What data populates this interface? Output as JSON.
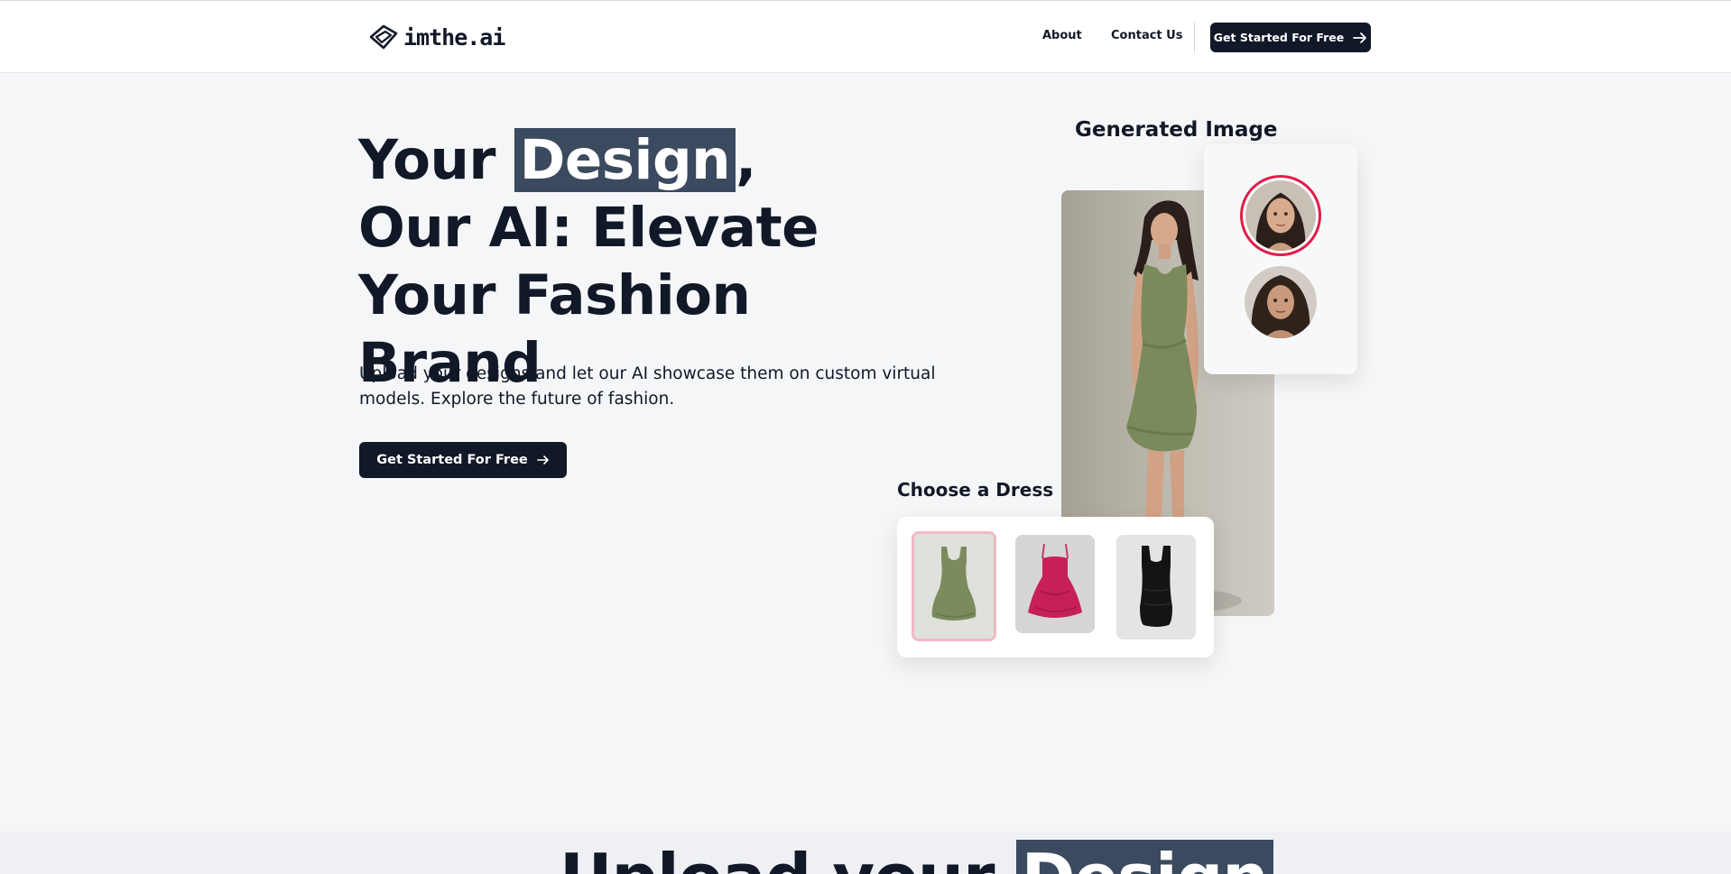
{
  "header": {
    "logo_text": "imthe.ai",
    "nav": [
      "About",
      "Contact Us"
    ],
    "cta_label": "Get Started For Free"
  },
  "hero": {
    "title_before": "Your ",
    "title_highlight": "Design",
    "title_after": ", Our AI: Elevate Your Fashion Brand",
    "subtitle": "Upload your designs and let our AI showcase them on custom virtual models. Explore the future of fashion.",
    "cta_label": "Get Started For Free"
  },
  "preview": {
    "generated_label": "Generated Image",
    "choose_label": "Choose a Dress",
    "selected_avatar": 1,
    "selected_dress": 1,
    "dresses": [
      "green-dress",
      "pink-dress",
      "black-dress"
    ]
  },
  "next_section": {
    "title_before": "Upload your ",
    "title_highlight": "Design"
  },
  "colors": {
    "primary": "#111827",
    "highlight": "#3b4a5e",
    "accent_ring": "#e11d48",
    "selected_dress_border": "#f5b8c5"
  }
}
